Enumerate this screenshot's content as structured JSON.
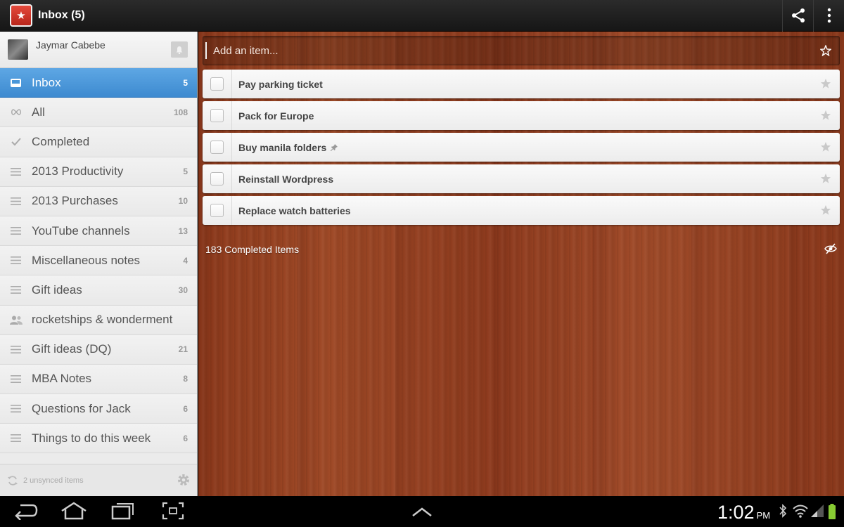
{
  "header": {
    "logo_glyph": "★",
    "title": "Inbox (5)"
  },
  "user": {
    "name": "Jaymar Cabebe"
  },
  "lists": [
    {
      "label": "Inbox",
      "count": "5",
      "icon": "inbox-icon",
      "active": true
    },
    {
      "label": "All",
      "count": "108",
      "icon": "infinity-icon"
    },
    {
      "label": "Completed",
      "count": "",
      "icon": "checkmark-icon"
    },
    {
      "label": "2013 Productivity",
      "count": "5",
      "icon": "list-icon"
    },
    {
      "label": "2013 Purchases",
      "count": "10",
      "icon": "list-icon"
    },
    {
      "label": "YouTube channels",
      "count": "13",
      "icon": "list-icon"
    },
    {
      "label": "Miscellaneous notes",
      "count": "4",
      "icon": "list-icon"
    },
    {
      "label": "Gift ideas",
      "count": "30",
      "icon": "list-icon"
    },
    {
      "label": "rocketships & wonderment",
      "count": "",
      "icon": "shared-users-icon"
    },
    {
      "label": "Gift ideas (DQ)",
      "count": "21",
      "icon": "list-icon"
    },
    {
      "label": "MBA Notes",
      "count": "8",
      "icon": "list-icon"
    },
    {
      "label": "Questions for Jack",
      "count": "6",
      "icon": "list-icon"
    },
    {
      "label": "Things to do this week",
      "count": "6",
      "icon": "list-icon"
    }
  ],
  "sidebar_footer": {
    "sync_text": "2 unsynced items"
  },
  "main": {
    "add_placeholder": "Add an item...",
    "tasks": [
      {
        "label": "Pay parking ticket",
        "pinned": false
      },
      {
        "label": "Pack for Europe",
        "pinned": false
      },
      {
        "label": "Buy manila folders",
        "pinned": true
      },
      {
        "label": "Reinstall Wordpress",
        "pinned": false
      },
      {
        "label": "Replace watch batteries",
        "pinned": false
      }
    ],
    "completed_text": "183 Completed Items"
  },
  "system": {
    "time": "1:02",
    "ampm": "PM"
  },
  "colors": {
    "accent": "#4a97d9",
    "logo_red": "#d0362a",
    "wood": "#9a4424"
  }
}
